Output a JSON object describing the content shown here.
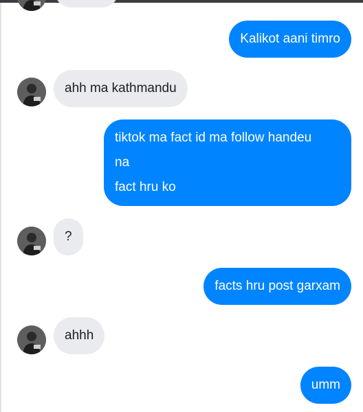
{
  "colors": {
    "outgoing": "#0084ff",
    "incoming": "#e9ebee",
    "incoming_text": "#1c1e21",
    "outgoing_text": "#ffffff"
  },
  "messages": [
    {
      "sender": "contact",
      "text": ""
    },
    {
      "sender": "me",
      "text": "Kalikot aani timro"
    },
    {
      "sender": "contact",
      "text": "ahh ma kathmandu",
      "avatar": "user-avatar-icon"
    },
    {
      "sender": "me",
      "lines": [
        "tiktok ma fact id ma follow handeu",
        "na",
        "fact hru ko"
      ]
    },
    {
      "sender": "contact",
      "text": "?",
      "avatar": "user-avatar-icon"
    },
    {
      "sender": "me",
      "text": "facts hru post garxam"
    },
    {
      "sender": "contact",
      "text": "ahhh",
      "avatar": "user-avatar-icon"
    },
    {
      "sender": "me",
      "text": "umm"
    }
  ]
}
